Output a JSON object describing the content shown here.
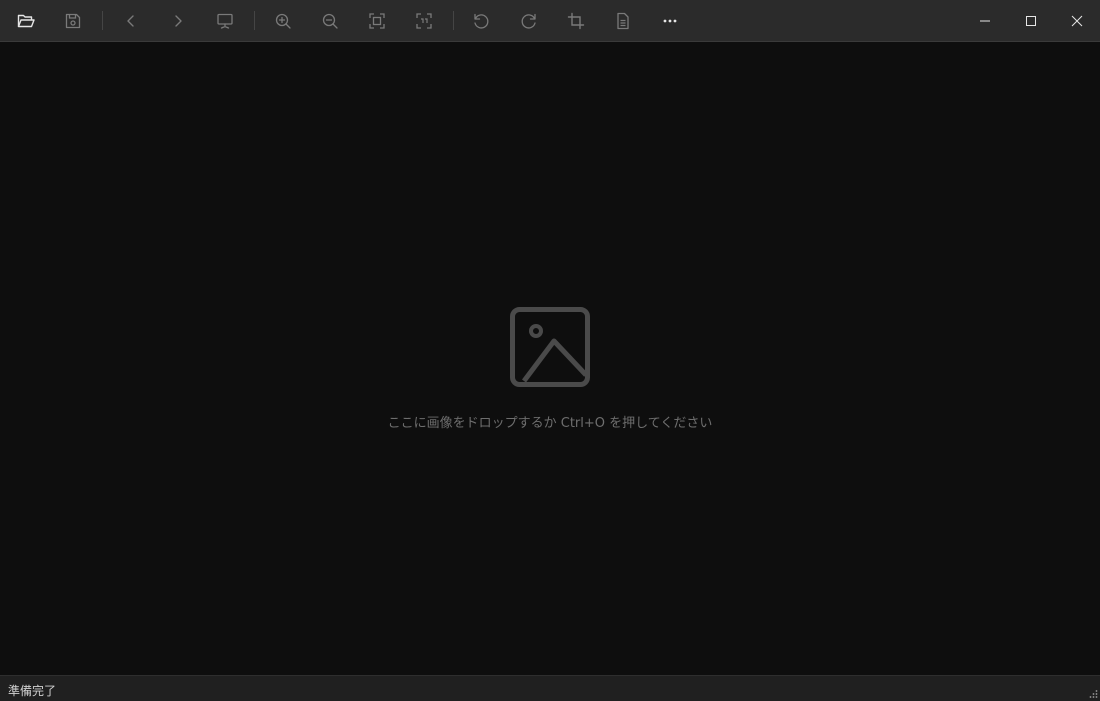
{
  "toolbar": {
    "buttons": [
      {
        "id": "open",
        "icon": "folder-open-icon"
      },
      {
        "id": "save",
        "icon": "save-icon"
      },
      {
        "id": "previous",
        "icon": "chevron-left-icon"
      },
      {
        "id": "next",
        "icon": "chevron-right-icon"
      },
      {
        "id": "slideshow",
        "icon": "slideshow-icon"
      },
      {
        "id": "zoom-in",
        "icon": "zoom-in-icon"
      },
      {
        "id": "zoom-out",
        "icon": "zoom-out-icon"
      },
      {
        "id": "fit-to-window",
        "icon": "fit-window-icon"
      },
      {
        "id": "actual-size",
        "icon": "actual-size-icon"
      },
      {
        "id": "rotate-left",
        "icon": "rotate-left-icon"
      },
      {
        "id": "rotate-right",
        "icon": "rotate-right-icon"
      },
      {
        "id": "crop",
        "icon": "crop-icon"
      },
      {
        "id": "info",
        "icon": "document-icon"
      },
      {
        "id": "more",
        "icon": "more-icon"
      }
    ]
  },
  "window_controls": {
    "minimize": "minimize-icon",
    "maximize": "maximize-icon",
    "close": "close-icon"
  },
  "canvas": {
    "placeholder_icon": "image-icon",
    "placeholder_text": "ここに画像をドロップするか Ctrl+O を押してください"
  },
  "status": {
    "text": "準備完了"
  },
  "colors": {
    "titlebar": "#2b2b2b",
    "canvas": "#0e0e0e",
    "statusbar": "#202020",
    "icon_active": "#e6e6e6",
    "icon_disabled": "#7a7a7a",
    "placeholder": "#4a4a4a"
  }
}
